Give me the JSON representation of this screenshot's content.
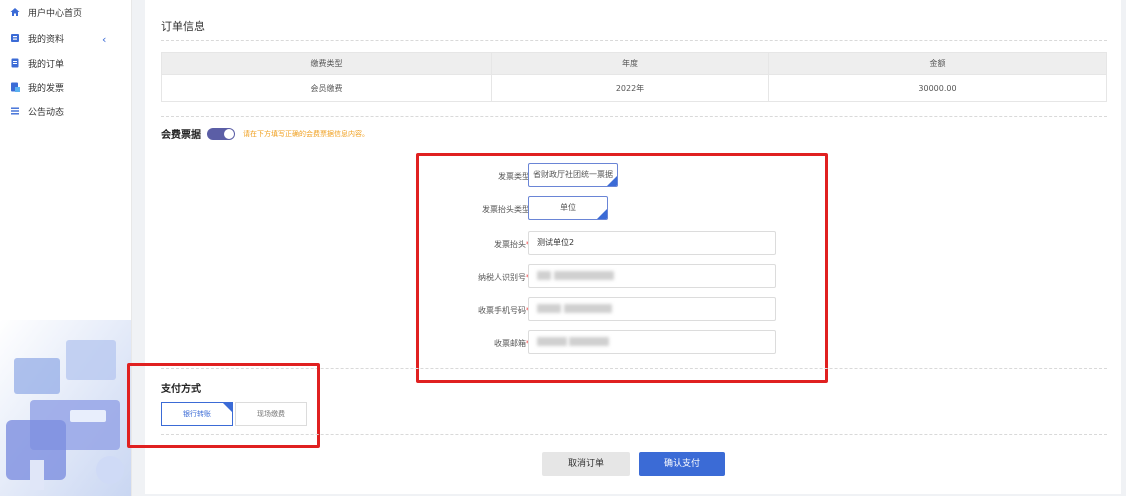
{
  "sidebar": {
    "items": [
      {
        "label": "用户中心首页",
        "icon": "home-icon"
      },
      {
        "label": "我的资料",
        "icon": "profile-icon"
      },
      {
        "label": "我的订单",
        "icon": "order-icon"
      },
      {
        "label": "我的发票",
        "icon": "invoice-icon"
      },
      {
        "label": "公告动态",
        "icon": "menu-icon"
      }
    ],
    "collapse_glyph": "‹"
  },
  "order": {
    "title": "订单信息",
    "headers": [
      "缴费类型",
      "年度",
      "金额"
    ],
    "row": [
      "会员缴费",
      "2022年",
      "30000.00"
    ]
  },
  "fee_receipt": {
    "title": "会费票据",
    "hint": "请在下方填写正确的会费票据信息内容。",
    "enabled": true
  },
  "form": {
    "invoice_type": {
      "label": "发票类型",
      "value": "省财政厅社团统一票据"
    },
    "title_type": {
      "label": "发票抬头类型",
      "value": "单位"
    },
    "invoice_title": {
      "label": "发票抬头",
      "required": "*",
      "value": "测试单位2"
    },
    "tax_id": {
      "label": "纳税人识别号",
      "required": "*"
    },
    "phone": {
      "label": "收票手机号码",
      "required": "*"
    },
    "email": {
      "label": "收票邮箱",
      "required": "*"
    }
  },
  "payment": {
    "title": "支付方式",
    "options": [
      "银行转账",
      "现场缴费"
    ],
    "selected": "银行转账"
  },
  "actions": {
    "cancel": "取消订单",
    "confirm": "确认支付"
  },
  "colors": {
    "accent": "#3b6bd6",
    "toggle": "#5b5ea6",
    "highlight": "#e02020",
    "hint": "#f0a020"
  }
}
